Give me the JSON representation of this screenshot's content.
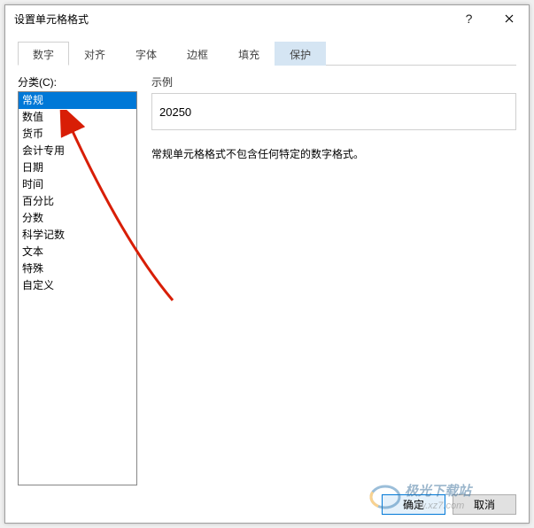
{
  "dialog": {
    "title": "设置单元格格式"
  },
  "tabs": [
    {
      "label": "数字",
      "active": true
    },
    {
      "label": "对齐",
      "active": false
    },
    {
      "label": "字体",
      "active": false
    },
    {
      "label": "边框",
      "active": false
    },
    {
      "label": "填充",
      "active": false
    },
    {
      "label": "保护",
      "active": false,
      "highlight": true
    }
  ],
  "category": {
    "label": "分类(C):",
    "items": [
      "常规",
      "数值",
      "货币",
      "会计专用",
      "日期",
      "时间",
      "百分比",
      "分数",
      "科学记数",
      "文本",
      "特殊",
      "自定义"
    ],
    "selected_index": 0
  },
  "sample": {
    "label": "示例",
    "value": "20250"
  },
  "description": "常规单元格格式不包含任何特定的数字格式。",
  "buttons": {
    "ok": "确定",
    "cancel": "取消"
  },
  "watermark": {
    "line1": "极光下载站",
    "line2": "www.xz7.com"
  }
}
